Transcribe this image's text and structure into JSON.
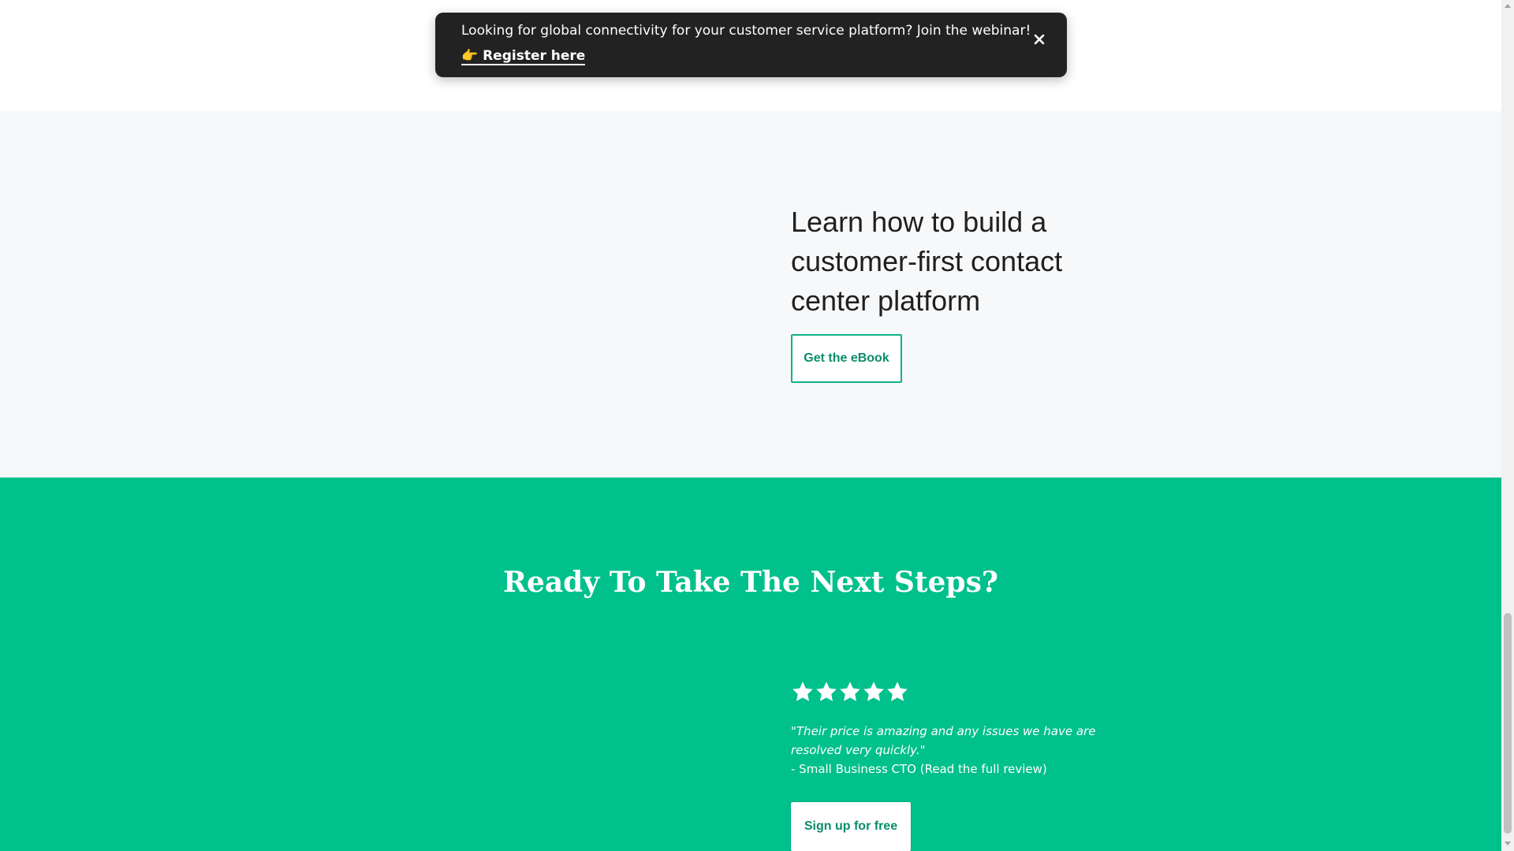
{
  "banner": {
    "message": "Looking for global connectivity for your customer service platform? Join the webinar!",
    "link_label": "👉 Register here",
    "close_icon": "close-icon",
    "background_color": "#222222"
  },
  "ebook": {
    "heading": "Learn how to build a customer-first contact center platform",
    "button_label": "Get the eBook",
    "accent_color": "#0fb385"
  },
  "cta": {
    "heading": "Ready To Take The Next Steps?",
    "rating": {
      "stars": 5,
      "max": 5,
      "icon": "star-icon"
    },
    "quote": "\"Their price is amazing and any issues we have are resolved very quickly.\"",
    "attribution": "- Small Business CTO (Read the full review)",
    "button_label": "Sign up for free",
    "background_color": "#00c08b"
  },
  "scrollbar": {
    "up_icon": "scroll-up-arrow-icon",
    "down_icon": "scroll-down-arrow-icon"
  }
}
